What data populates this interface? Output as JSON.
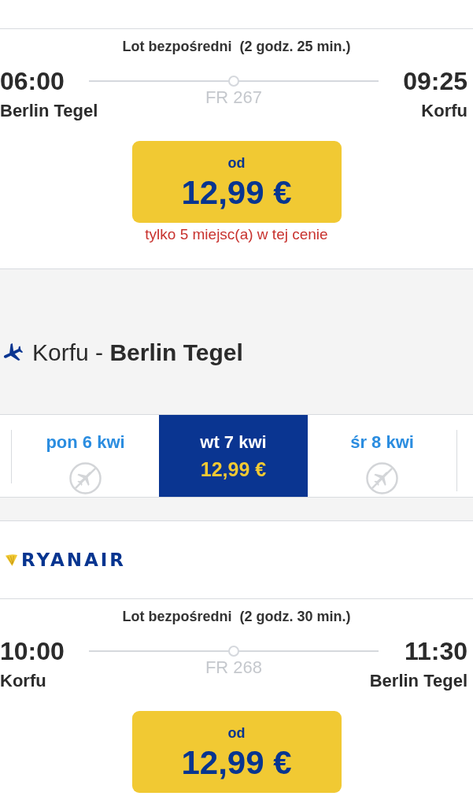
{
  "outbound": {
    "flights": [
      {
        "summary": "Lot bezpośredni  (2 godz. 25 min.)",
        "departure": {
          "time": "06:00",
          "airport": "Berlin Tegel"
        },
        "flight_number": "FR 267",
        "arrival": {
          "time": "09:25",
          "airport": "Korfu"
        },
        "price": {
          "prefix": "od",
          "amount": "12,99 €"
        },
        "seats_note": "tylko 5 miejsc(a) w tej cenie"
      }
    ]
  },
  "return": {
    "title": "Korfu - **Berlin Tegel**",
    "date_tabs": [
      {
        "label": "pon 6 kwi",
        "selected": false,
        "available": false
      },
      {
        "label": "wt 7 kwi",
        "selected": true,
        "available": true,
        "price": "12,99 €"
      },
      {
        "label": "śr 8 kwi",
        "selected": false,
        "available": false
      }
    ],
    "flights": [
      {
        "airline": "RYANAIR",
        "summary": "Lot bezpośredni  (2 godz. 30 min.)",
        "departure": {
          "time": "10:00",
          "airport": "Korfu"
        },
        "flight_number": "FR 268",
        "arrival": {
          "time": "11:30",
          "airport": "Berlin Tegel"
        },
        "price": {
          "prefix": "od",
          "amount": "12,99 €"
        }
      }
    ]
  }
}
